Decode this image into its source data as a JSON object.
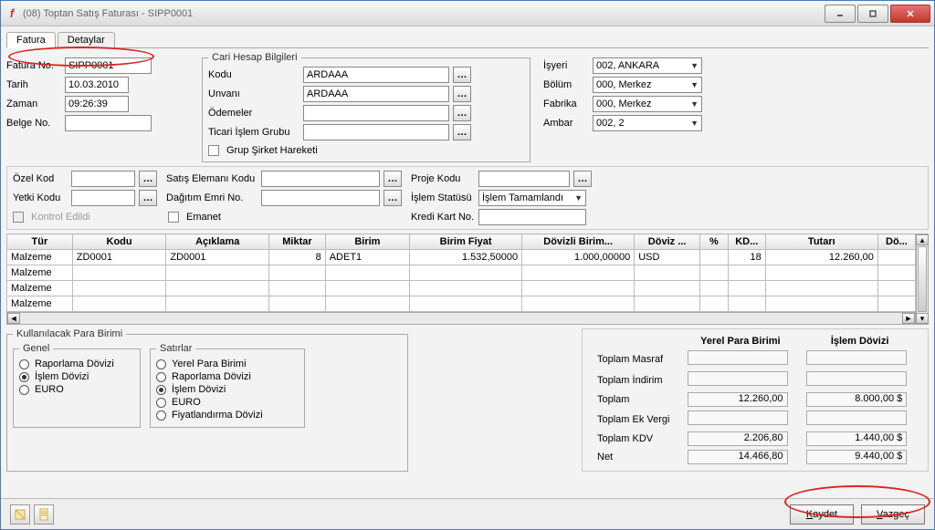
{
  "window": {
    "title": "(08) Toptan Satış Faturası - SIPP0001"
  },
  "tabs": {
    "active": "Fatura",
    "inactive": "Detaylar"
  },
  "header": {
    "fatura_no_label": "Fatura No.",
    "fatura_no": "SIPP0001",
    "tarih_label": "Tarih",
    "tarih": "10.03.2010",
    "zaman_label": "Zaman",
    "zaman": "09:26:39",
    "belge_no_label": "Belge No.",
    "belge_no": ""
  },
  "cari": {
    "legend": "Cari Hesap Bilgileri",
    "kodu_label": "Kodu",
    "kodu": "ARDAAA",
    "unvani_label": "Unvanı",
    "unvani": "ARDAAA",
    "odemeler_label": "Ödemeler",
    "odemeler": "",
    "tig_label": "Ticari İşlem Grubu",
    "tig": "",
    "grup_sirket_label": "Grup Şirket Hareketi"
  },
  "org": {
    "isyeri_label": "İşyeri",
    "isyeri": "002, ANKARA",
    "bolum_label": "Bölüm",
    "bolum": "000, Merkez",
    "fabrika_label": "Fabrika",
    "fabrika": "000, Merkez",
    "ambar_label": "Ambar",
    "ambar": "002, 2"
  },
  "mid": {
    "ozel_kod_label": "Özel Kod",
    "yetki_kodu_label": "Yetki Kodu",
    "kontrol_edildi_label": "Kontrol Edildi",
    "satis_eleman_label": "Satış Elemanı Kodu",
    "dagitim_emri_label": "Dağıtım Emri No.",
    "emanet_label": "Emanet",
    "proje_kodu_label": "Proje Kodu",
    "islem_statusu_label": "İşlem Statüsü",
    "islem_statusu": "İşlem Tamamlandı",
    "kredi_kart_label": "Kredi Kart No."
  },
  "grid": {
    "columns": [
      "Tür",
      "Kodu",
      "Açıklama",
      "Miktar",
      "Birim",
      "Birim Fiyat",
      "Dövizli Birim...",
      "Döviz ...",
      "%",
      "KD...",
      "Tutarı",
      "Dö..."
    ],
    "rows": [
      {
        "tur": "Malzeme",
        "kodu": "ZD0001",
        "aciklama": "ZD0001",
        "miktar": "8",
        "birim": "ADET1",
        "birim_fiyat": "1.532,50000",
        "dovizli_birim": "1.000,00000",
        "doviz": "USD",
        "yuzde": "",
        "kd": "18",
        "tutar": "12.260,00",
        "dov": ""
      },
      {
        "tur": "Malzeme"
      },
      {
        "tur": "Malzeme"
      },
      {
        "tur": "Malzeme"
      }
    ]
  },
  "currency_panel": {
    "legend": "Kullanılacak Para Birimi",
    "genel_legend": "Genel",
    "genel_options": [
      "Raporlama Dövizi",
      "İşlem Dövizi",
      "EURO"
    ],
    "genel_selected": 1,
    "satirlar_legend": "Satırlar",
    "satirlar_options": [
      "Yerel Para Birimi",
      "Raporlama Dövizi",
      "İşlem Dövizi",
      "EURO",
      "Fiyatlandırma Dövizi"
    ],
    "satirlar_selected": 2
  },
  "totals": {
    "col1_header": "Yerel Para Birimi",
    "col2_header": "İşlem Dövizi",
    "rows": [
      {
        "label": "Toplam Masraf",
        "ypb": "",
        "idv": ""
      },
      {
        "label": "Toplam İndirim",
        "ypb": "",
        "idv": ""
      },
      {
        "label": "Toplam",
        "ypb": "12.260,00",
        "idv": "8.000,00 $"
      },
      {
        "label": "Toplam Ek Vergi",
        "ypb": "",
        "idv": ""
      },
      {
        "label": "Toplam KDV",
        "ypb": "2.206,80",
        "idv": "1.440,00 $"
      },
      {
        "label": "Net",
        "ypb": "14.466,80",
        "idv": "9.440,00 $"
      }
    ]
  },
  "buttons": {
    "kaydet": "Kaydet",
    "vazgec": "Vazgeç"
  }
}
